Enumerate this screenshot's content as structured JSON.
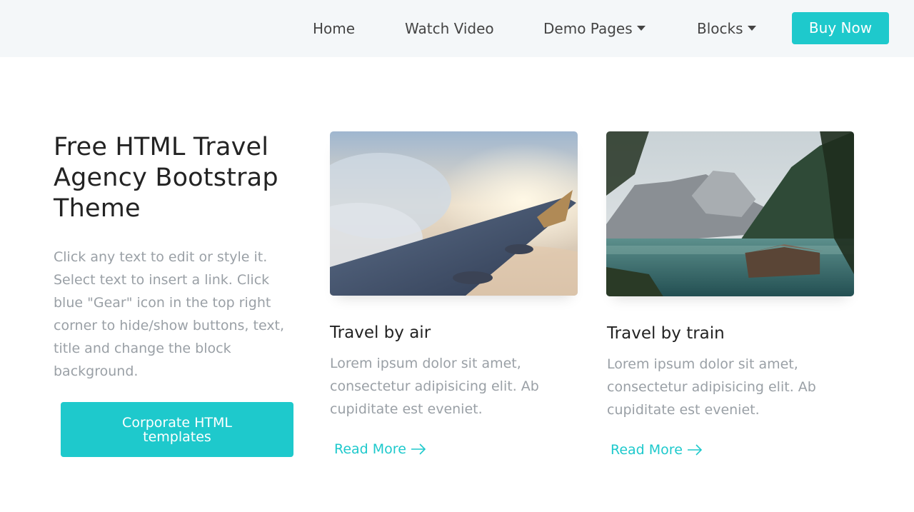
{
  "nav": {
    "items": [
      {
        "label": "Home",
        "has_dropdown": false
      },
      {
        "label": "Watch Video",
        "has_dropdown": false
      },
      {
        "label": "Demo Pages",
        "has_dropdown": true
      },
      {
        "label": "Blocks",
        "has_dropdown": true
      }
    ],
    "buy_label": "Buy Now"
  },
  "hero": {
    "title": "Free HTML Travel Agency Bootstrap Theme",
    "text": "Click any text to edit or style it. Select text to insert a link. Click blue \"Gear\" icon in the top right corner to hide/show buttons, text, title and change the block background.",
    "cta_label": "Corporate HTML templates"
  },
  "cards": [
    {
      "image_icon": "airplane-wing-photo",
      "title": "Travel by air",
      "text": "Lorem ipsum dolor sit amet, consectetur adipisicing elit. Ab cupiditate est eveniet.",
      "link_label": "Read More"
    },
    {
      "image_icon": "mountain-lake-photo",
      "title": "Travel by train",
      "text": "Lorem ipsum dolor sit amet, consectetur adipisicing elit. Ab cupiditate est eveniet.",
      "link_label": "Read More"
    }
  ],
  "colors": {
    "accent": "#1ec9cc",
    "nav_bg": "#f4f7f9",
    "muted_text": "#9aa0a6",
    "heading_text": "#232323"
  }
}
